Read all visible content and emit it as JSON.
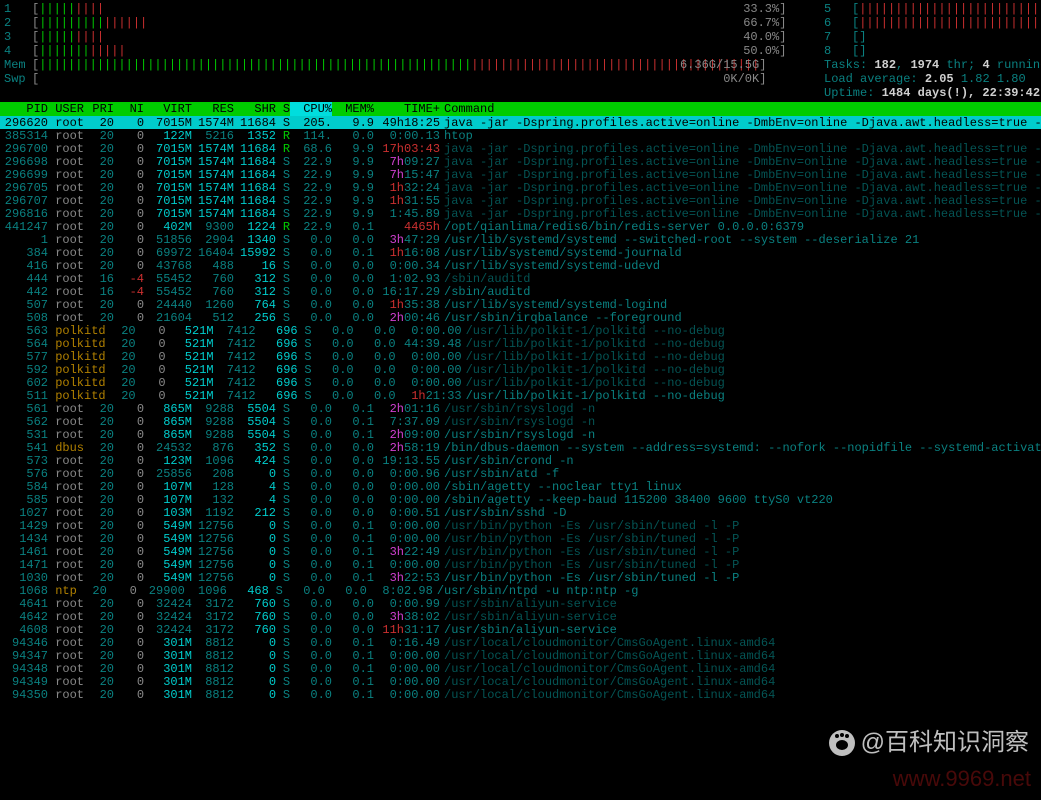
{
  "cpu_meters_left": [
    {
      "label": "1",
      "fill": "|||||||||",
      "color": "mix",
      "pct": "33.3%"
    },
    {
      "label": "2",
      "fill": "|||||||||||||||",
      "color": "mix",
      "pct": "66.7%"
    },
    {
      "label": "3",
      "fill": "|||||||||",
      "color": "mix",
      "pct": "40.0%"
    },
    {
      "label": "4",
      "fill": "||||||||||||",
      "color": "mix",
      "pct": "50.0%"
    }
  ],
  "cpu_meters_right": [
    {
      "label": "5",
      "fill": "|||||||||||||||||||||||||||||||",
      "pct": ""
    },
    {
      "label": "6",
      "fill": "|||||||||||||||||||||||||||||||",
      "pct": ""
    },
    {
      "label": "7",
      "fill": "",
      "pct": ""
    },
    {
      "label": "8",
      "fill": "",
      "pct": ""
    }
  ],
  "mem": {
    "label": "Mem",
    "fill": "||||||||||||||||||||||||||||||||||||||||||||||||||||||||||||||||||||||||||||||||||||||||||||||||||||||||||||||||",
    "pct": "6.36G/15.5G"
  },
  "swp": {
    "label": "Swp",
    "fill": "",
    "pct": "0K/0K"
  },
  "tasks": {
    "label": "Tasks:",
    "total": "182",
    "threads": "1974",
    "thr_label": "thr;",
    "running": "4",
    "running_label": "running"
  },
  "loadavg": {
    "label": "Load average:",
    "v1": "2.05",
    "v2": "1.82",
    "v3": "1.80"
  },
  "uptime": {
    "label": "Uptime:",
    "value": "1484 days(!), 22:39:42"
  },
  "columns": [
    "PID",
    "USER",
    "PRI",
    "NI",
    "VIRT",
    "RES",
    "SHR",
    "S",
    "CPU%",
    "MEM%",
    "TIME+",
    "Command"
  ],
  "selected_col": "CPU%",
  "processes": [
    {
      "pid": "296620",
      "user": "root",
      "pri": "20",
      "ni": "0",
      "virt": "7015M",
      "res": "1574M",
      "shr": "11684",
      "s": "S",
      "cpu": "205.",
      "mem": "9.9",
      "time": "49h18:25",
      "cmd": "java -jar -Dspring.profiles.active=online -DmbEnv=online -Djava.awt.headless=true -Djava.n",
      "sel": true
    },
    {
      "pid": "385314",
      "user": "root",
      "pri": "20",
      "ni": "0",
      "virt": "122M",
      "res": "5216",
      "shr": "1352",
      "s": "R",
      "cpu": "114.",
      "mem": "0.0",
      "time": "0:00.13",
      "cmd": "htop",
      "cmd_style": "active"
    },
    {
      "pid": "296700",
      "user": "root",
      "pri": "20",
      "ni": "0",
      "virt": "7015M",
      "res": "1574M",
      "shr": "11684",
      "s": "R",
      "cpu": "68.6",
      "mem": "9.9",
      "time": "17h03:43",
      "cmd": "java -jar -Dspring.profiles.active=online -DmbEnv=online -Djava.awt.headless=true -Djava.n",
      "cmd_style": "dim",
      "time_style": "red"
    },
    {
      "pid": "296698",
      "user": "root",
      "pri": "20",
      "ni": "0",
      "virt": "7015M",
      "res": "1574M",
      "shr": "11684",
      "s": "S",
      "cpu": "22.9",
      "mem": "9.9",
      "time": "7h09:27",
      "cmd": "java -jar -Dspring.profiles.active=online -DmbEnv=online -Djava.awt.headless=true -Djava.n",
      "cmd_style": "dim",
      "time_style": "magenta"
    },
    {
      "pid": "296699",
      "user": "root",
      "pri": "20",
      "ni": "0",
      "virt": "7015M",
      "res": "1574M",
      "shr": "11684",
      "s": "S",
      "cpu": "22.9",
      "mem": "9.9",
      "time": "7h15:47",
      "cmd": "java -jar -Dspring.profiles.active=online -DmbEnv=online -Djava.awt.headless=true -Djava.n",
      "cmd_style": "dim",
      "time_style": "magenta"
    },
    {
      "pid": "296705",
      "user": "root",
      "pri": "20",
      "ni": "0",
      "virt": "7015M",
      "res": "1574M",
      "shr": "11684",
      "s": "S",
      "cpu": "22.9",
      "mem": "9.9",
      "time": "1h32:24",
      "cmd": "java -jar -Dspring.profiles.active=online -DmbEnv=online -Djava.awt.headless=true -Djava.n",
      "cmd_style": "dim",
      "time_style": "red1h"
    },
    {
      "pid": "296707",
      "user": "root",
      "pri": "20",
      "ni": "0",
      "virt": "7015M",
      "res": "1574M",
      "shr": "11684",
      "s": "S",
      "cpu": "22.9",
      "mem": "9.9",
      "time": "1h31:55",
      "cmd": "java -jar -Dspring.profiles.active=online -DmbEnv=online -Djava.awt.headless=true -Djava.n",
      "cmd_style": "dim",
      "time_style": "red1h"
    },
    {
      "pid": "296816",
      "user": "root",
      "pri": "20",
      "ni": "0",
      "virt": "7015M",
      "res": "1574M",
      "shr": "11684",
      "s": "S",
      "cpu": "22.9",
      "mem": "9.9",
      "time": "1:45.89",
      "cmd": "java -jar -Dspring.profiles.active=online -DmbEnv=online -Djava.awt.headless=true -Djava.n",
      "cmd_style": "dim"
    },
    {
      "pid": "441247",
      "user": "root",
      "pri": "20",
      "ni": "0",
      "virt": "402M",
      "res": "9300",
      "shr": "1224",
      "s": "R",
      "cpu": "22.9",
      "mem": "0.1",
      "time": "4465h",
      "cmd": "/opt/qianlima/redis6/bin/redis-server 0.0.0.0:6379",
      "cmd_style": "active",
      "time_style": "red"
    },
    {
      "pid": "1",
      "user": "root",
      "pri": "20",
      "ni": "0",
      "virt": "51856",
      "res": "2904",
      "shr": "1340",
      "s": "S",
      "cpu": "0.0",
      "mem": "0.0",
      "time": "3h47:29",
      "cmd": "/usr/lib/systemd/systemd --switched-root --system --deserialize 21",
      "cmd_style": "active",
      "time_style": "magenta3h"
    },
    {
      "pid": "384",
      "user": "root",
      "pri": "20",
      "ni": "0",
      "virt": "69972",
      "res": "16404",
      "shr": "15992",
      "s": "S",
      "cpu": "0.0",
      "mem": "0.1",
      "time": "1h16:08",
      "cmd": "/usr/lib/systemd/systemd-journald",
      "cmd_style": "active",
      "time_style": "red1h"
    },
    {
      "pid": "416",
      "user": "root",
      "pri": "20",
      "ni": "0",
      "virt": "43768",
      "res": "488",
      "shr": "16",
      "s": "S",
      "cpu": "0.0",
      "mem": "0.0",
      "time": "0:00.34",
      "cmd": "/usr/lib/systemd/systemd-udevd",
      "cmd_style": "active"
    },
    {
      "pid": "444",
      "user": "root",
      "pri": "16",
      "ni": "-4",
      "virt": "55452",
      "res": "760",
      "shr": "312",
      "s": "S",
      "cpu": "0.0",
      "mem": "0.0",
      "time": "1:02.93",
      "cmd": "/sbin/auditd",
      "cmd_style": "dim",
      "ni_style": "red"
    },
    {
      "pid": "442",
      "user": "root",
      "pri": "16",
      "ni": "-4",
      "virt": "55452",
      "res": "760",
      "shr": "312",
      "s": "S",
      "cpu": "0.0",
      "mem": "0.0",
      "time": "16:17.29",
      "cmd": "/sbin/auditd",
      "cmd_style": "active",
      "ni_style": "red"
    },
    {
      "pid": "507",
      "user": "root",
      "pri": "20",
      "ni": "0",
      "virt": "24440",
      "res": "1260",
      "shr": "764",
      "s": "S",
      "cpu": "0.0",
      "mem": "0.0",
      "time": "1h35:38",
      "cmd": "/usr/lib/systemd/systemd-logind",
      "cmd_style": "active",
      "time_style": "red1h"
    },
    {
      "pid": "508",
      "user": "root",
      "pri": "20",
      "ni": "0",
      "virt": "21604",
      "res": "512",
      "shr": "256",
      "s": "S",
      "cpu": "0.0",
      "mem": "0.0",
      "time": "2h00:46",
      "cmd": "/usr/sbin/irqbalance --foreground",
      "cmd_style": "active",
      "time_style": "magenta2h"
    },
    {
      "pid": "563",
      "user": "polkitd",
      "pri": "20",
      "ni": "0",
      "virt": "521M",
      "res": "7412",
      "shr": "696",
      "s": "S",
      "cpu": "0.0",
      "mem": "0.0",
      "time": "0:00.00",
      "cmd": "/usr/lib/polkit-1/polkitd --no-debug",
      "cmd_style": "dim",
      "user_style": "orange"
    },
    {
      "pid": "564",
      "user": "polkitd",
      "pri": "20",
      "ni": "0",
      "virt": "521M",
      "res": "7412",
      "shr": "696",
      "s": "S",
      "cpu": "0.0",
      "mem": "0.0",
      "time": "44:39.48",
      "cmd": "/usr/lib/polkit-1/polkitd --no-debug",
      "cmd_style": "dim",
      "user_style": "orange"
    },
    {
      "pid": "577",
      "user": "polkitd",
      "pri": "20",
      "ni": "0",
      "virt": "521M",
      "res": "7412",
      "shr": "696",
      "s": "S",
      "cpu": "0.0",
      "mem": "0.0",
      "time": "0:00.00",
      "cmd": "/usr/lib/polkit-1/polkitd --no-debug",
      "cmd_style": "dim",
      "user_style": "orange"
    },
    {
      "pid": "592",
      "user": "polkitd",
      "pri": "20",
      "ni": "0",
      "virt": "521M",
      "res": "7412",
      "shr": "696",
      "s": "S",
      "cpu": "0.0",
      "mem": "0.0",
      "time": "0:00.00",
      "cmd": "/usr/lib/polkit-1/polkitd --no-debug",
      "cmd_style": "dim",
      "user_style": "orange"
    },
    {
      "pid": "602",
      "user": "polkitd",
      "pri": "20",
      "ni": "0",
      "virt": "521M",
      "res": "7412",
      "shr": "696",
      "s": "S",
      "cpu": "0.0",
      "mem": "0.0",
      "time": "0:00.00",
      "cmd": "/usr/lib/polkit-1/polkitd --no-debug",
      "cmd_style": "dim",
      "user_style": "orange"
    },
    {
      "pid": "511",
      "user": "polkitd",
      "pri": "20",
      "ni": "0",
      "virt": "521M",
      "res": "7412",
      "shr": "696",
      "s": "S",
      "cpu": "0.0",
      "mem": "0.0",
      "time": "1h21:33",
      "cmd": "/usr/lib/polkit-1/polkitd --no-debug",
      "cmd_style": "active",
      "user_style": "orange",
      "time_style": "red1h"
    },
    {
      "pid": "561",
      "user": "root",
      "pri": "20",
      "ni": "0",
      "virt": "865M",
      "res": "9288",
      "shr": "5504",
      "s": "S",
      "cpu": "0.0",
      "mem": "0.1",
      "time": "2h01:16",
      "cmd": "/usr/sbin/rsyslogd -n",
      "cmd_style": "dim",
      "time_style": "magenta2h"
    },
    {
      "pid": "562",
      "user": "root",
      "pri": "20",
      "ni": "0",
      "virt": "865M",
      "res": "9288",
      "shr": "5504",
      "s": "S",
      "cpu": "0.0",
      "mem": "0.1",
      "time": "7:37.09",
      "cmd": "/usr/sbin/rsyslogd -n",
      "cmd_style": "dim"
    },
    {
      "pid": "531",
      "user": "root",
      "pri": "20",
      "ni": "0",
      "virt": "865M",
      "res": "9288",
      "shr": "5504",
      "s": "S",
      "cpu": "0.0",
      "mem": "0.1",
      "time": "2h09:00",
      "cmd": "/usr/sbin/rsyslogd -n",
      "cmd_style": "active",
      "time_style": "magenta2h"
    },
    {
      "pid": "541",
      "user": "dbus",
      "pri": "20",
      "ni": "0",
      "virt": "24532",
      "res": "876",
      "shr": "352",
      "s": "S",
      "cpu": "0.0",
      "mem": "0.0",
      "time": "2h58:19",
      "cmd": "/bin/dbus-daemon --system --address=systemd: --nofork --nopidfile --systemd-activation",
      "cmd_style": "active",
      "user_style": "orange",
      "time_style": "magenta2h"
    },
    {
      "pid": "573",
      "user": "root",
      "pri": "20",
      "ni": "0",
      "virt": "123M",
      "res": "1096",
      "shr": "424",
      "s": "S",
      "cpu": "0.0",
      "mem": "0.0",
      "time": "19:13.55",
      "cmd": "/usr/sbin/crond -n",
      "cmd_style": "active"
    },
    {
      "pid": "576",
      "user": "root",
      "pri": "20",
      "ni": "0",
      "virt": "25856",
      "res": "208",
      "shr": "0",
      "s": "S",
      "cpu": "0.0",
      "mem": "0.0",
      "time": "0:00.96",
      "cmd": "/usr/sbin/atd -f",
      "cmd_style": "active"
    },
    {
      "pid": "584",
      "user": "root",
      "pri": "20",
      "ni": "0",
      "virt": "107M",
      "res": "128",
      "shr": "4",
      "s": "S",
      "cpu": "0.0",
      "mem": "0.0",
      "time": "0:00.00",
      "cmd": "/sbin/agetty --noclear tty1 linux",
      "cmd_style": "active"
    },
    {
      "pid": "585",
      "user": "root",
      "pri": "20",
      "ni": "0",
      "virt": "107M",
      "res": "132",
      "shr": "4",
      "s": "S",
      "cpu": "0.0",
      "mem": "0.0",
      "time": "0:00.00",
      "cmd": "/sbin/agetty --keep-baud 115200 38400 9600 ttyS0 vt220",
      "cmd_style": "active"
    },
    {
      "pid": "1027",
      "user": "root",
      "pri": "20",
      "ni": "0",
      "virt": "103M",
      "res": "1192",
      "shr": "212",
      "s": "S",
      "cpu": "0.0",
      "mem": "0.0",
      "time": "0:00.51",
      "cmd": "/usr/sbin/sshd -D",
      "cmd_style": "active"
    },
    {
      "pid": "1429",
      "user": "root",
      "pri": "20",
      "ni": "0",
      "virt": "549M",
      "res": "12756",
      "shr": "0",
      "s": "S",
      "cpu": "0.0",
      "mem": "0.1",
      "time": "0:00.00",
      "cmd": "/usr/bin/python -Es /usr/sbin/tuned -l -P",
      "cmd_style": "dim"
    },
    {
      "pid": "1434",
      "user": "root",
      "pri": "20",
      "ni": "0",
      "virt": "549M",
      "res": "12756",
      "shr": "0",
      "s": "S",
      "cpu": "0.0",
      "mem": "0.1",
      "time": "0:00.00",
      "cmd": "/usr/bin/python -Es /usr/sbin/tuned -l -P",
      "cmd_style": "dim"
    },
    {
      "pid": "1461",
      "user": "root",
      "pri": "20",
      "ni": "0",
      "virt": "549M",
      "res": "12756",
      "shr": "0",
      "s": "S",
      "cpu": "0.0",
      "mem": "0.1",
      "time": "3h22:49",
      "cmd": "/usr/bin/python -Es /usr/sbin/tuned -l -P",
      "cmd_style": "dim",
      "time_style": "magenta3h"
    },
    {
      "pid": "1471",
      "user": "root",
      "pri": "20",
      "ni": "0",
      "virt": "549M",
      "res": "12756",
      "shr": "0",
      "s": "S",
      "cpu": "0.0",
      "mem": "0.1",
      "time": "0:00.00",
      "cmd": "/usr/bin/python -Es /usr/sbin/tuned -l -P",
      "cmd_style": "dim"
    },
    {
      "pid": "1030",
      "user": "root",
      "pri": "20",
      "ni": "0",
      "virt": "549M",
      "res": "12756",
      "shr": "0",
      "s": "S",
      "cpu": "0.0",
      "mem": "0.1",
      "time": "3h22:53",
      "cmd": "/usr/bin/python -Es /usr/sbin/tuned -l -P",
      "cmd_style": "active",
      "time_style": "magenta3h"
    },
    {
      "pid": "1068",
      "user": "ntp",
      "pri": "20",
      "ni": "0",
      "virt": "29900",
      "res": "1096",
      "shr": "468",
      "s": "S",
      "cpu": "0.0",
      "mem": "0.0",
      "time": "8:02.98",
      "cmd": "/usr/sbin/ntpd -u ntp:ntp -g",
      "cmd_style": "active",
      "user_style": "orange"
    },
    {
      "pid": "4641",
      "user": "root",
      "pri": "20",
      "ni": "0",
      "virt": "32424",
      "res": "3172",
      "shr": "760",
      "s": "S",
      "cpu": "0.0",
      "mem": "0.0",
      "time": "0:00.99",
      "cmd": "/usr/sbin/aliyun-service",
      "cmd_style": "dim"
    },
    {
      "pid": "4642",
      "user": "root",
      "pri": "20",
      "ni": "0",
      "virt": "32424",
      "res": "3172",
      "shr": "760",
      "s": "S",
      "cpu": "0.0",
      "mem": "0.0",
      "time": "3h38:02",
      "cmd": "/usr/sbin/aliyun-service",
      "cmd_style": "dim",
      "time_style": "magenta3h"
    },
    {
      "pid": "4608",
      "user": "root",
      "pri": "20",
      "ni": "0",
      "virt": "32424",
      "res": "3172",
      "shr": "760",
      "s": "S",
      "cpu": "0.0",
      "mem": "0.0",
      "time": "11h31:17",
      "cmd": "/usr/sbin/aliyun-service",
      "cmd_style": "active",
      "time_style": "red11h"
    },
    {
      "pid": "94346",
      "user": "root",
      "pri": "20",
      "ni": "0",
      "virt": "301M",
      "res": "8812",
      "shr": "0",
      "s": "S",
      "cpu": "0.0",
      "mem": "0.1",
      "time": "0:16.49",
      "cmd": "/usr/local/cloudmonitor/CmsGoAgent.linux-amd64",
      "cmd_style": "dim"
    },
    {
      "pid": "94347",
      "user": "root",
      "pri": "20",
      "ni": "0",
      "virt": "301M",
      "res": "8812",
      "shr": "0",
      "s": "S",
      "cpu": "0.0",
      "mem": "0.1",
      "time": "0:00.00",
      "cmd": "/usr/local/cloudmonitor/CmsGoAgent.linux-amd64",
      "cmd_style": "dim"
    },
    {
      "pid": "94348",
      "user": "root",
      "pri": "20",
      "ni": "0",
      "virt": "301M",
      "res": "8812",
      "shr": "0",
      "s": "S",
      "cpu": "0.0",
      "mem": "0.1",
      "time": "0:00.00",
      "cmd": "/usr/local/cloudmonitor/CmsGoAgent.linux-amd64",
      "cmd_style": "dim"
    },
    {
      "pid": "94349",
      "user": "root",
      "pri": "20",
      "ni": "0",
      "virt": "301M",
      "res": "8812",
      "shr": "0",
      "s": "S",
      "cpu": "0.0",
      "mem": "0.1",
      "time": "0:00.00",
      "cmd": "/usr/local/cloudmonitor/CmsGoAgent.linux-amd64",
      "cmd_style": "dim"
    },
    {
      "pid": "94350",
      "user": "root",
      "pri": "20",
      "ni": "0",
      "virt": "301M",
      "res": "8812",
      "shr": "0",
      "s": "S",
      "cpu": "0.0",
      "mem": "0.1",
      "time": "0:00.00",
      "cmd": "/usr/local/cloudmonitor/CmsGoAgent.linux-amd64",
      "cmd_style": "dim"
    }
  ],
  "watermark": "@百科知识洞察",
  "watermark_url": "www.9969.net"
}
